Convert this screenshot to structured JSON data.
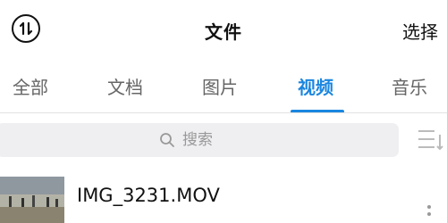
{
  "header": {
    "title": "文件",
    "select_label": "选择",
    "sort_icon": "sort-toggle-icon"
  },
  "tabs": [
    {
      "label": "全部",
      "active": false
    },
    {
      "label": "文档",
      "active": false
    },
    {
      "label": "图片",
      "active": false
    },
    {
      "label": "视频",
      "active": true
    },
    {
      "label": "音乐",
      "active": false
    }
  ],
  "search": {
    "placeholder": "搜索",
    "icon": "search-icon"
  },
  "list_view_icon": "list-view-icon",
  "files": [
    {
      "name": "IMG_3231.MOV",
      "thumbnail_icon": "video-thumbnail",
      "more_icon": "more-icon"
    }
  ],
  "colors": {
    "accent": "#1a86e0",
    "search_bg": "#efeff2",
    "inactive_tab": "#666666"
  }
}
